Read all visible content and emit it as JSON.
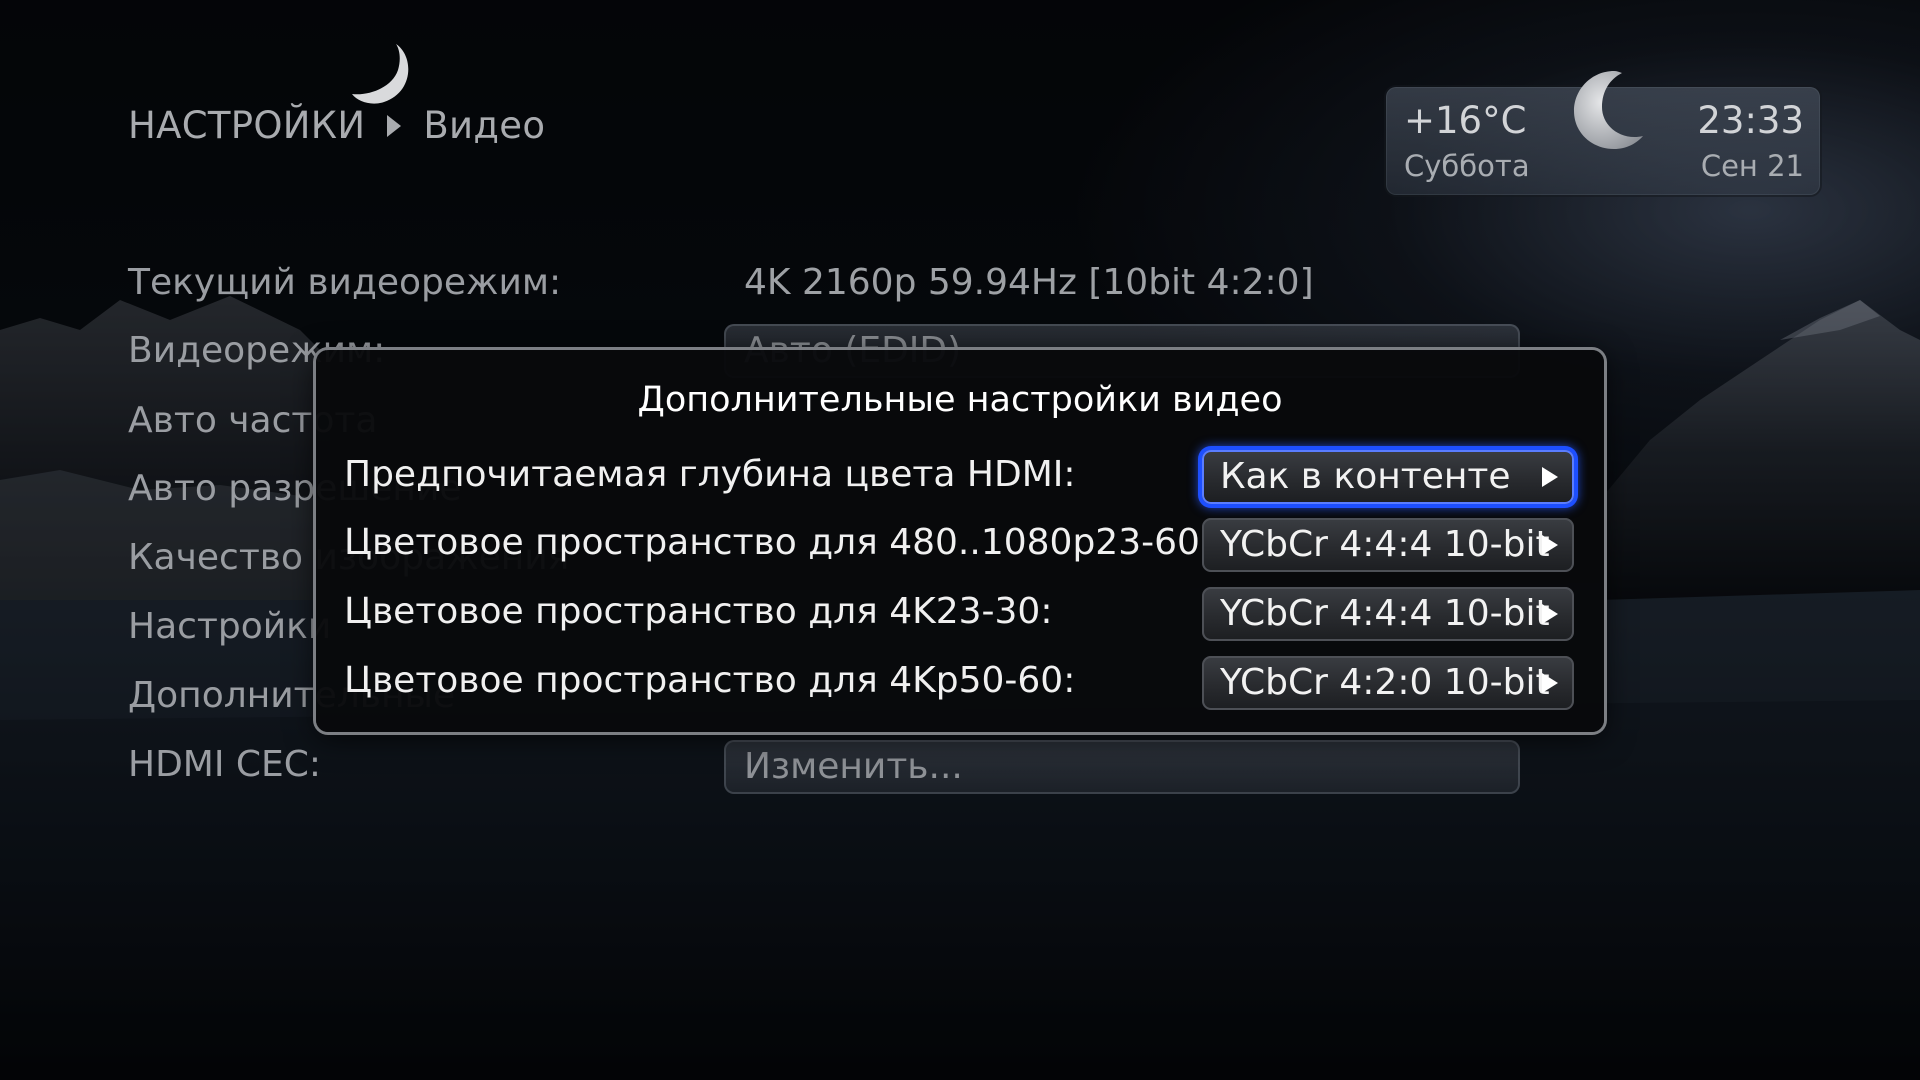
{
  "header": {
    "section": "НАСТРОЙКИ",
    "page": "Видео"
  },
  "weather": {
    "temperature": "+16°C",
    "time": "23:33",
    "day": "Суббота",
    "date": "Сен 21",
    "icon": "moon-icon"
  },
  "settings_list": {
    "items": [
      {
        "label": "Текущий видеорежим:",
        "value": "4K 2160p 59.94Hz [10bit 4:2:0]"
      },
      {
        "label": "Видеорежим:",
        "value": "Авто (EDID)"
      },
      {
        "label": "Авто частота",
        "value": ""
      },
      {
        "label": "Авто разрешение",
        "value": ""
      },
      {
        "label": "Качество изображения",
        "value": ""
      },
      {
        "label": "Настройки",
        "value": ""
      },
      {
        "label": "Дополнительные",
        "value": ""
      },
      {
        "label": "HDMI CEC:",
        "value": "Изменить..."
      }
    ]
  },
  "dialog": {
    "title": "Дополнительные настройки видео",
    "rows": [
      {
        "label": "Предпочитаемая глубина цвета HDMI:",
        "value": "Как в контенте",
        "focused": true
      },
      {
        "label": "Цветовое пространство для 480..1080p23-60:",
        "value": "YCbCr 4:4:4 10-bit",
        "focused": false
      },
      {
        "label": "Цветовое пространство для 4K23-30:",
        "value": "YCbCr 4:4:4 10-bit",
        "focused": false
      },
      {
        "label": "Цветовое пространство для 4Kp50-60:",
        "value": "YCbCr 4:2:0 10-bit",
        "focused": false
      }
    ]
  },
  "colors": {
    "focus_accent": "#1d4fff",
    "dialog_border": "#7c7f84"
  }
}
